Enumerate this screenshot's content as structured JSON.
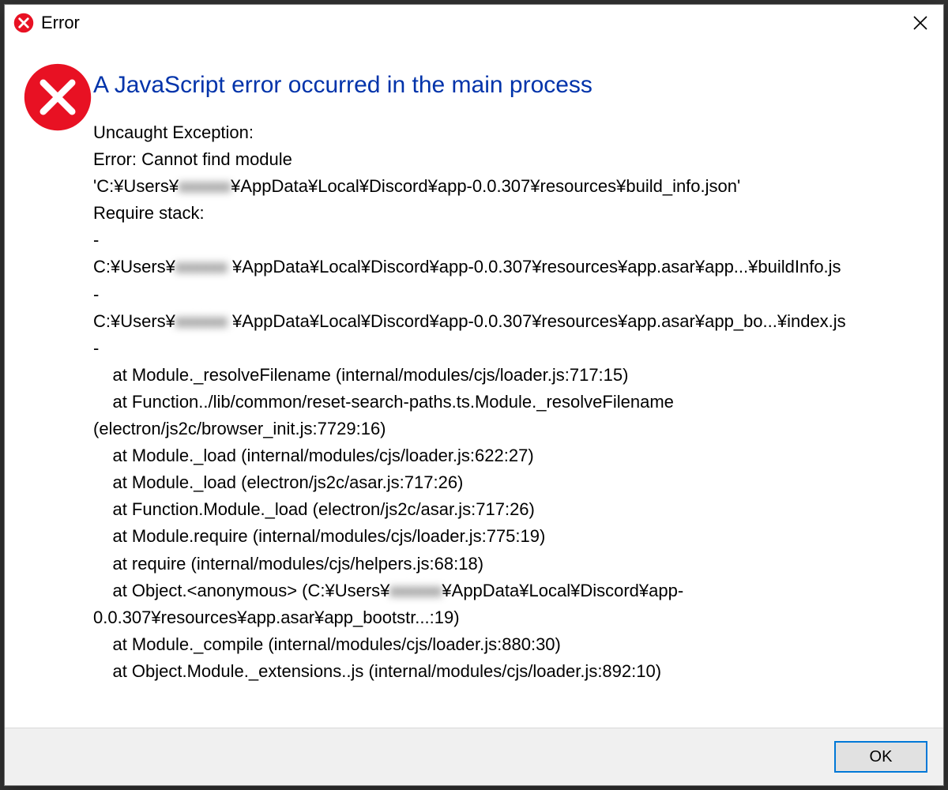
{
  "titlebar": {
    "title": "Error"
  },
  "dialog": {
    "main_instruction": "A JavaScript error occurred in the main process",
    "body_lines": [
      {
        "before": "Uncaught Exception:"
      },
      {
        "before": "Error: Cannot find module"
      },
      {
        "before": "'C:¥Users¥",
        "redacted": "xxxxxx",
        "after": "¥AppData¥Local¥Discord¥app-0.0.307¥resources¥build_info.json'"
      },
      {
        "before": "Require stack:"
      },
      {
        "before": "-"
      },
      {
        "before": "C:¥Users¥",
        "redacted": "xxxxxx",
        "after": " ¥AppData¥Local¥Discord¥app-0.0.307¥resources¥app.asar¥app...¥buildInfo.js"
      },
      {
        "before": "-"
      },
      {
        "before": "C:¥Users¥",
        "redacted": "xxxxxx",
        "after": " ¥AppData¥Local¥Discord¥app-0.0.307¥resources¥app.asar¥app_bo...¥index.js"
      },
      {
        "before": "-"
      },
      {
        "before": "    at Module._resolveFilename (internal/modules/cjs/loader.js:717:15)"
      },
      {
        "before": "    at Function../lib/common/reset-search-paths.ts.Module._resolveFilename (electron/js2c/browser_init.js:7729:16)"
      },
      {
        "before": "    at Module._load (internal/modules/cjs/loader.js:622:27)"
      },
      {
        "before": "    at Module._load (electron/js2c/asar.js:717:26)"
      },
      {
        "before": "    at Function.Module._load (electron/js2c/asar.js:717:26)"
      },
      {
        "before": "    at Module.require (internal/modules/cjs/loader.js:775:19)"
      },
      {
        "before": "    at require (internal/modules/cjs/helpers.js:68:18)"
      },
      {
        "before": "    at Object.<anonymous> (C:¥Users¥",
        "redacted": "xxxxxx",
        "after": "¥AppData¥Local¥Discord¥app-0.0.307¥resources¥app.asar¥app_bootstr...:19)"
      },
      {
        "before": "    at Module._compile (internal/modules/cjs/loader.js:880:30)"
      },
      {
        "before": "    at Object.Module._extensions..js (internal/modules/cjs/loader.js:892:10)"
      }
    ],
    "ok_label": "OK"
  }
}
